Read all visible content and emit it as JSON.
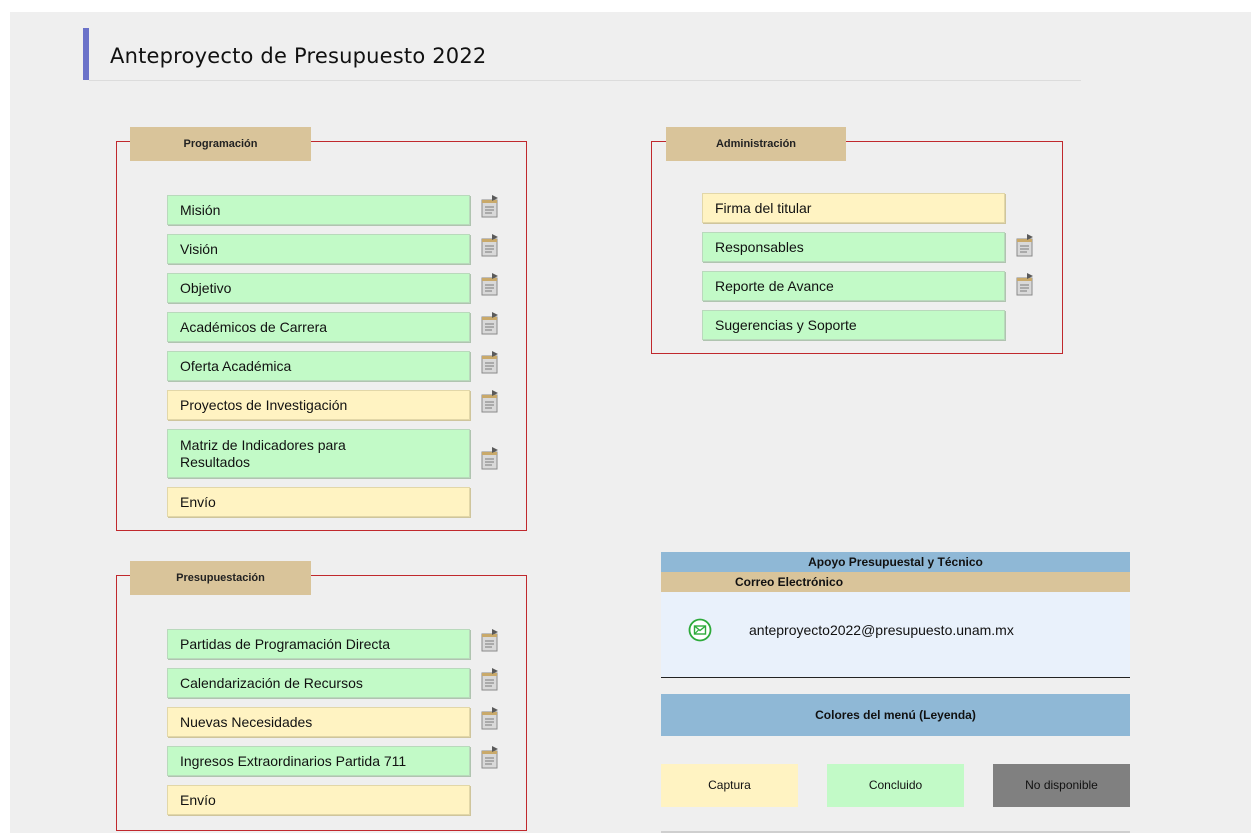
{
  "header": {
    "title": "Anteproyecto de Presupuesto 2022"
  },
  "programacion": {
    "legend": "Programación",
    "items": [
      {
        "label": "Misión",
        "status": "concluido",
        "has_icon": true
      },
      {
        "label": "Visión",
        "status": "concluido",
        "has_icon": true
      },
      {
        "label": "Objetivo",
        "status": "concluido",
        "has_icon": true
      },
      {
        "label": "Académicos de Carrera",
        "status": "concluido",
        "has_icon": true
      },
      {
        "label": "Oferta Académica",
        "status": "concluido",
        "has_icon": true
      },
      {
        "label": "Proyectos de Investigación",
        "status": "captura",
        "has_icon": true
      },
      {
        "label": "Matriz de Indicadores para Resultados",
        "status": "concluido",
        "has_icon": true
      },
      {
        "label": "Envío",
        "status": "captura",
        "has_icon": false
      }
    ]
  },
  "administracion": {
    "legend": "Administración",
    "items": [
      {
        "label": "Firma del titular",
        "status": "captura",
        "has_icon": false
      },
      {
        "label": "Responsables",
        "status": "concluido",
        "has_icon": true
      },
      {
        "label": "Reporte de Avance",
        "status": "concluido",
        "has_icon": true
      },
      {
        "label": "Sugerencias y Soporte",
        "status": "concluido",
        "has_icon": false
      }
    ]
  },
  "presupuestacion": {
    "legend": "Presupuestación",
    "items": [
      {
        "label": "Partidas de Programación Directa",
        "status": "concluido",
        "has_icon": true
      },
      {
        "label": "Calendarización de Recursos",
        "status": "concluido",
        "has_icon": true
      },
      {
        "label": "Nuevas Necesidades",
        "status": "captura",
        "has_icon": true
      },
      {
        "label": "Ingresos Extraordinarios Partida 711",
        "status": "concluido",
        "has_icon": true
      },
      {
        "label": "Envío",
        "status": "captura",
        "has_icon": false
      }
    ]
  },
  "support": {
    "header": "Apoyo Presupuestal y Técnico",
    "subheader": "Correo Electrónico",
    "email": "anteproyecto2022@presupuesto.unam.mx",
    "icon": "mail-icon"
  },
  "color_legend": {
    "header": "Colores del menú (Leyenda)",
    "captura": "Captura",
    "concluido": "Concluido",
    "no_disponible": "No disponible"
  },
  "colors": {
    "captura": "#fff3c2",
    "concluido": "#c2fac7",
    "no_disponible": "#808080",
    "fieldset_border": "#c0282d",
    "legend_bg": "#d9c49a",
    "info_header": "#8fb8d6",
    "title_accent": "#6b72c9"
  }
}
